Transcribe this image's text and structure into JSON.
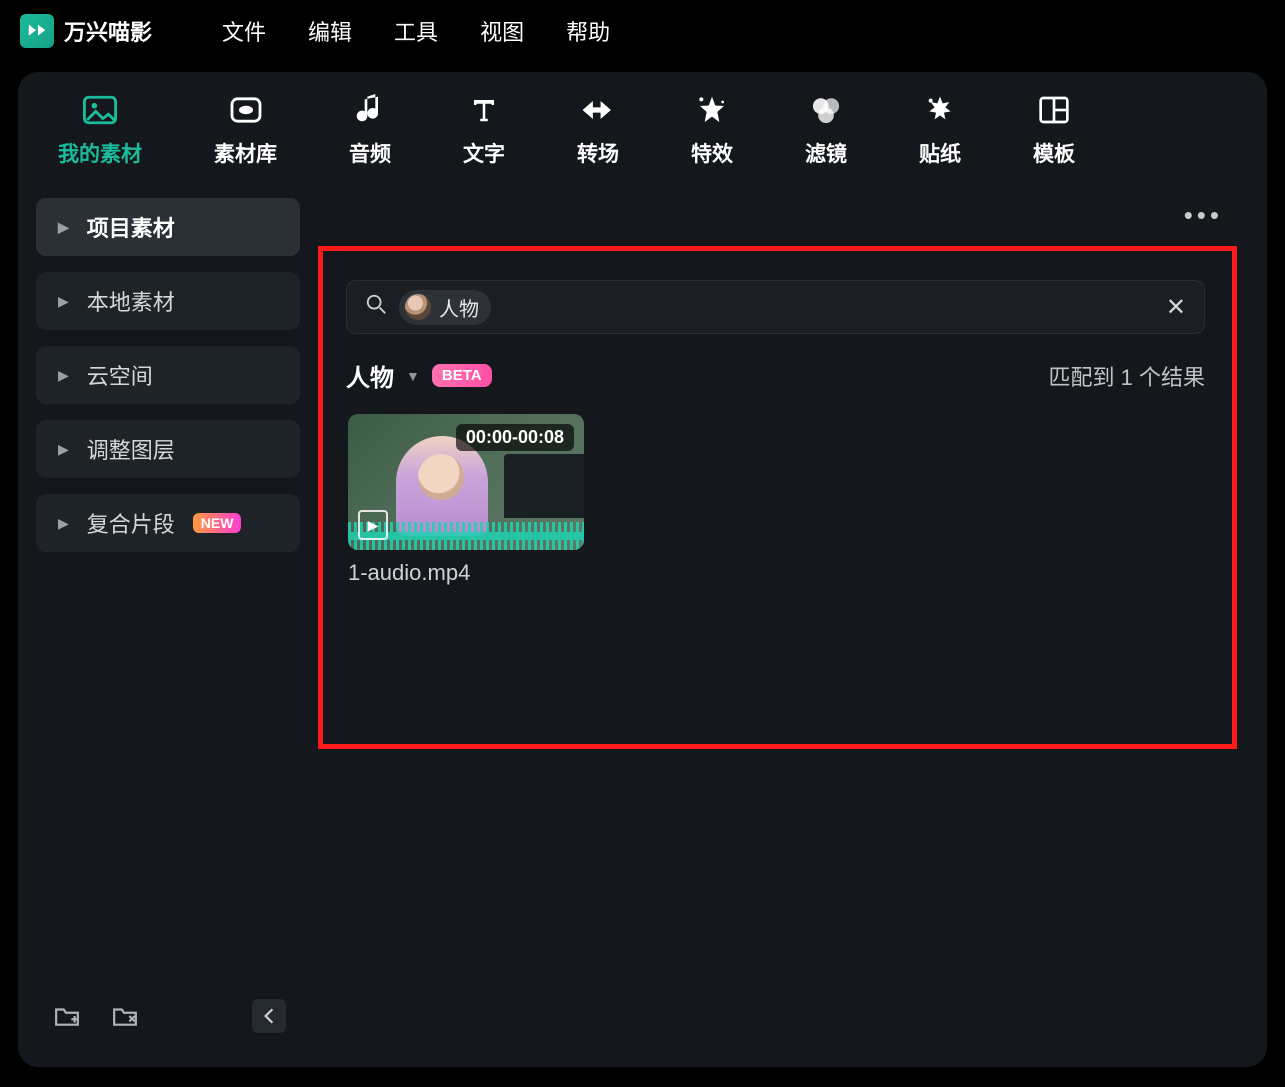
{
  "app": {
    "name": "万兴喵影"
  },
  "menu": {
    "file": "文件",
    "edit": "编辑",
    "tools": "工具",
    "view": "视图",
    "help": "帮助"
  },
  "toolbar": {
    "my_media": "我的素材",
    "stock": "素材库",
    "audio": "音频",
    "text": "文字",
    "transition": "转场",
    "effects": "特效",
    "filters": "滤镜",
    "stickers": "贴纸",
    "templates": "模板"
  },
  "sidebar": {
    "items": [
      {
        "label": "项目素材"
      },
      {
        "label": "本地素材"
      },
      {
        "label": "云空间"
      },
      {
        "label": "调整图层"
      },
      {
        "label": "复合片段",
        "new": "NEW"
      }
    ]
  },
  "search": {
    "chip_label": "人物"
  },
  "filter": {
    "label": "人物",
    "beta": "BETA"
  },
  "results": {
    "count_text": "匹配到 1 个结果"
  },
  "clip": {
    "time": "00:00-00:08",
    "name": "1-audio.mp4"
  }
}
